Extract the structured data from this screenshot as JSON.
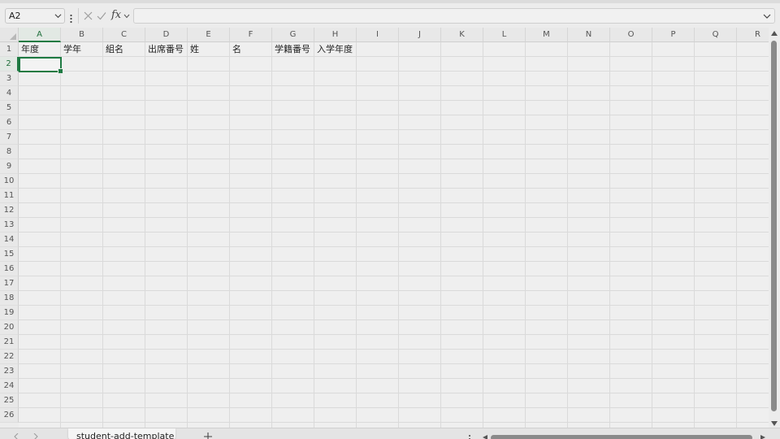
{
  "formula_bar": {
    "name_box": "A2",
    "fx_label": "fx",
    "formula_value": ""
  },
  "columns": [
    "A",
    "B",
    "C",
    "D",
    "E",
    "F",
    "G",
    "H",
    "I",
    "J",
    "K",
    "L",
    "M",
    "N",
    "O",
    "P",
    "Q",
    "R"
  ],
  "rows": [
    "1",
    "2",
    "3",
    "4",
    "5",
    "6",
    "7",
    "8",
    "9",
    "10",
    "11",
    "12",
    "13",
    "14",
    "15",
    "16",
    "17",
    "18",
    "19",
    "20",
    "21",
    "22",
    "23",
    "24",
    "25",
    "26"
  ],
  "row1_cells": {
    "A": "年度",
    "B": "学年",
    "C": "組名",
    "D": "出席番号",
    "E": "姓",
    "F": "名",
    "G": "学籍番号",
    "H": "入学年度"
  },
  "selected_cell": "A2",
  "sheet_tabs": [
    {
      "label": "student-add-template",
      "active": true
    }
  ],
  "icons": {
    "name_box_dropdown": "chevron-down-icon",
    "more": "vertical-dots-icon",
    "cancel": "close-icon",
    "enter": "check-icon",
    "function": "fx-icon",
    "expand_formula": "chevron-down-icon",
    "add_sheet": "plus-icon"
  },
  "colors": {
    "accent": "#1e7a42"
  }
}
